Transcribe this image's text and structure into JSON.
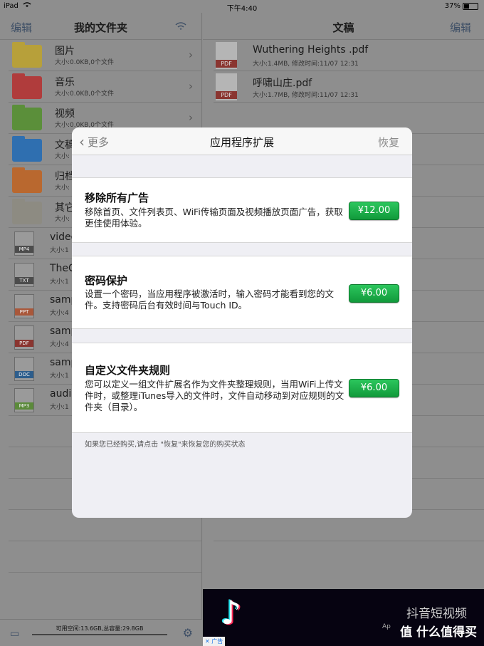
{
  "status": {
    "device": "iPad",
    "time": "下午4:40",
    "battery": "37%"
  },
  "left": {
    "edit": "编辑",
    "title": "我的文件夹",
    "folders": [
      {
        "name": "图片",
        "meta": "大小:0.0KB,0个文件",
        "color": "#b7a03a"
      },
      {
        "name": "音乐",
        "meta": "大小:0.0KB,0个文件",
        "color": "#b03c3c"
      },
      {
        "name": "视频",
        "meta": "大小:0.0KB,0个文件",
        "color": "#5b8f3a"
      },
      {
        "name": "文稿",
        "meta": "大小:",
        "color": "#2f6fb0"
      },
      {
        "name": "归档",
        "meta": "大小:",
        "color": "#b9682f"
      },
      {
        "name": "其它",
        "meta": "大小:",
        "color": "#8d8b82"
      }
    ],
    "files": [
      {
        "name": "video",
        "meta": "大小:1",
        "tag": "MP4",
        "tagcolor": "#4c4c4c"
      },
      {
        "name": "TheC",
        "meta": "大小:1",
        "tag": "TXT",
        "tagcolor": "#4c4c4c"
      },
      {
        "name": "samp",
        "meta": "大小:4",
        "tag": "PPT",
        "tagcolor": "#a9573a"
      },
      {
        "name": "samp",
        "meta": "大小:4",
        "tag": "PDF",
        "tagcolor": "#8a3530"
      },
      {
        "name": "samp",
        "meta": "大小:1",
        "tag": "DOC",
        "tagcolor": "#2d5d8c"
      },
      {
        "name": "audio",
        "meta": "大小:1",
        "tag": "MP3",
        "tagcolor": "#5b8a3a"
      }
    ],
    "storage": "可用空间:13.6GB,总容量:29.8GB"
  },
  "right": {
    "title": "文稿",
    "edit": "编辑",
    "files": [
      {
        "name": "Wuthering Heights .pdf",
        "meta": "大小:1.4MB, 修改时间:11/07 12:31",
        "tag": "PDF"
      },
      {
        "name": "呼啸山庄.pdf",
        "meta": "大小:1.7MB, 修改时间:11/07 12:31",
        "tag": "PDF"
      }
    ]
  },
  "ad": {
    "brand": "抖音短视频",
    "small": "Ap",
    "watermark": "值 什么值得买",
    "label": "✕ 广告"
  },
  "modal": {
    "back": "更多",
    "title": "应用程序扩展",
    "restore": "恢复",
    "items": [
      {
        "title": "移除所有广告",
        "desc": "移除首页、文件列表页、WiFi传输页面及视频播放页面广告，获取更佳使用体验。",
        "price": "¥12.00"
      },
      {
        "title": "密码保护",
        "desc": "设置一个密码，当应用程序被激活时，输入密码才能看到您的文件。支持密码后台有效时间与Touch ID。",
        "price": "¥6.00"
      },
      {
        "title": "自定义文件夹规则",
        "desc": "您可以定义一组文件扩展名作为文件夹整理规则，当用WiFi上传文件时，或整理iTunes导入的文件时，文件自动移动到对应规则的文件夹（目录）。",
        "price": "¥6.00"
      }
    ],
    "note": "如果您已经购买,请点击 \"恢复\"来恢复您的购买状态"
  }
}
